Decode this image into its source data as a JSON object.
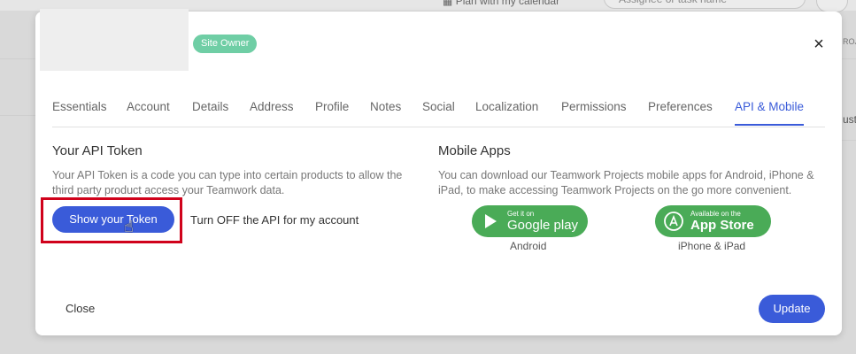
{
  "background": {
    "calendar_text": "Plan with my calendar",
    "search_placeholder": "Assignee or task name",
    "edge_text_1": "ROJ",
    "edge_text_2": "ust"
  },
  "modal": {
    "badge": "Site Owner",
    "tabs": [
      {
        "label": "Essentials"
      },
      {
        "label": "Account"
      },
      {
        "label": "Details"
      },
      {
        "label": "Address"
      },
      {
        "label": "Profile"
      },
      {
        "label": "Notes"
      },
      {
        "label": "Social"
      },
      {
        "label": "Localization"
      },
      {
        "label": "Permissions"
      },
      {
        "label": "Preferences"
      },
      {
        "label": "API & Mobile",
        "active": true
      }
    ],
    "api": {
      "title": "Your API Token",
      "description": "Your API Token is a code you can type into certain products to allow the third party product access your Teamwork data.",
      "show_token_label": "Show your Token",
      "toggle_label": "Turn OFF the API for my account"
    },
    "mobile": {
      "title": "Mobile Apps",
      "description": "You can download our Teamwork Projects mobile apps for Android, iPhone & iPad, to make accessing Teamwork Projects on the go more convenient.",
      "google": {
        "small": "Get it on",
        "big": "Google play",
        "caption": "Android"
      },
      "apple": {
        "small": "Available on the",
        "big": "App Store",
        "caption": "iPhone & iPad"
      }
    },
    "footer": {
      "close_label": "Close",
      "update_label": "Update"
    }
  },
  "colors": {
    "accent": "#3a5bd9",
    "badge": "#6fcea5",
    "store_green": "#4aab57",
    "highlight": "#d0021b"
  }
}
